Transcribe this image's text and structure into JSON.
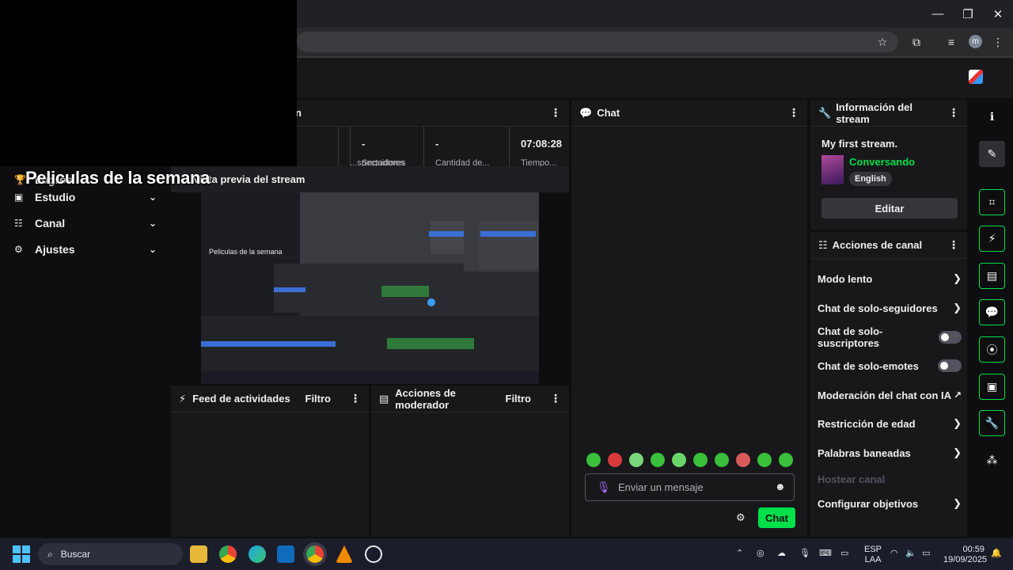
{
  "browser": {
    "win_minimize": "—",
    "win_maximize": "❐",
    "win_close": "✕",
    "avatar_initial": "m",
    "icons": [
      "star-icon",
      "extensions-icon",
      "media-icon",
      "profile-avatar",
      "menu-icon"
    ]
  },
  "overlay_text": "Peliculas de la semana",
  "sidebar": {
    "items": [
      {
        "label": "Logros",
        "icon": "trophy-icon"
      },
      {
        "label": "Estudio",
        "icon": "studio-icon"
      },
      {
        "label": "Canal",
        "icon": "channel-icon"
      },
      {
        "label": "Ajustes",
        "icon": "settings-icon"
      }
    ]
  },
  "stats_panel": {
    "title_fragment": "n",
    "cells": [
      {
        "value": "",
        "label": "...spectadores"
      },
      {
        "value": "-",
        "label": "Seguidores"
      },
      {
        "value": "-",
        "label": "Cantidad de..."
      },
      {
        "value": "07:08:28",
        "label": "Tiempo..."
      }
    ]
  },
  "preview": {
    "title": "Vista previa del stream",
    "inner_text": "Peliculas de la semana"
  },
  "activity_feed": {
    "title": "Feed de actividades",
    "filter": "Filtro"
  },
  "mod_actions": {
    "title": "Acciones de moderador",
    "filter": "Filtro"
  },
  "chat": {
    "title": "Chat",
    "input_placeholder": "Enviar un mensaje",
    "send_label": "Chat",
    "emote_colors": [
      "#3ac03a",
      "#d83a3a",
      "#7ad67a",
      "#3ac03a",
      "#6ad66a",
      "#3ac03a",
      "#3ac03a",
      "#d85a5a",
      "#3ac03a",
      "#3ac03a"
    ]
  },
  "stream_info": {
    "title": "Información del stream",
    "stream_title": "My first stream.",
    "category": "Conversando",
    "language": "English",
    "edit_label": "Editar"
  },
  "channel_actions": {
    "title": "Acciones de canal",
    "items": [
      {
        "label": "Modo lento",
        "control": "arrow"
      },
      {
        "label": "Chat de solo-seguidores",
        "control": "arrow"
      },
      {
        "label": "Chat de solo-suscriptores",
        "control": "toggle"
      },
      {
        "label": "Chat de solo-emotes",
        "control": "toggle"
      },
      {
        "label": "Moderación del chat con IA",
        "control": "external"
      },
      {
        "label": "Restricción de edad",
        "control": "arrow"
      },
      {
        "label": "Palabras baneadas",
        "control": "arrow"
      },
      {
        "label": "Hostear canal",
        "control": "disabled"
      },
      {
        "label": "Configurar objetivos",
        "control": "arrow"
      }
    ]
  },
  "taskbar": {
    "search_placeholder": "Buscar",
    "lang_line1": "ESP",
    "lang_line2": "LAA",
    "time": "00:59",
    "date": "19/09/2025"
  },
  "colors": {
    "accent_green": "#00e04b",
    "category_green": "#00e04b",
    "panel_bg": "#18181b",
    "page_bg": "#0e0e10"
  }
}
